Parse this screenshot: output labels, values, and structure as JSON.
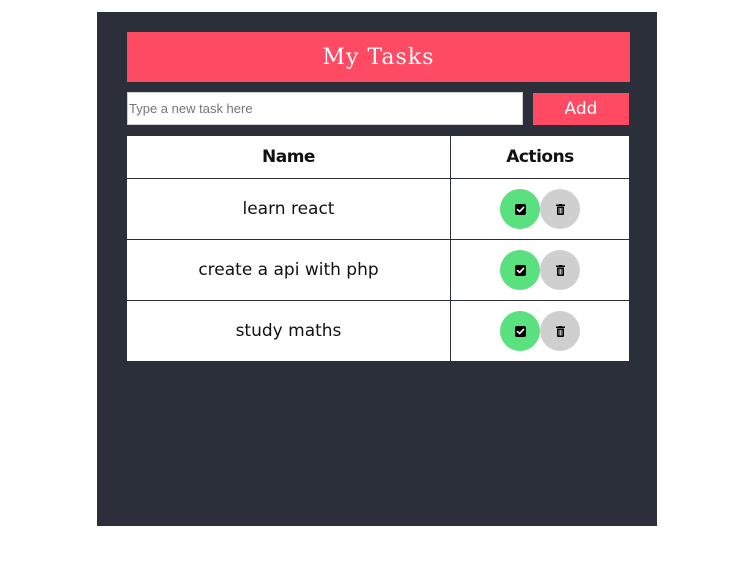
{
  "header": {
    "title": "My Tasks"
  },
  "input": {
    "placeholder": "Type a new task here",
    "value": ""
  },
  "add_button": {
    "label": "Add"
  },
  "table": {
    "columns": [
      "Name",
      "Actions"
    ],
    "rows": [
      {
        "name": "learn react"
      },
      {
        "name": "create a api with php"
      },
      {
        "name": "study maths"
      }
    ]
  },
  "icons": {
    "complete": "check-square-icon",
    "delete": "trash-icon"
  },
  "colors": {
    "panel_bg": "#2b2f3a",
    "accent": "#fe4b63",
    "done_button": "#5ae07f",
    "delete_button": "#cfcfcf"
  }
}
